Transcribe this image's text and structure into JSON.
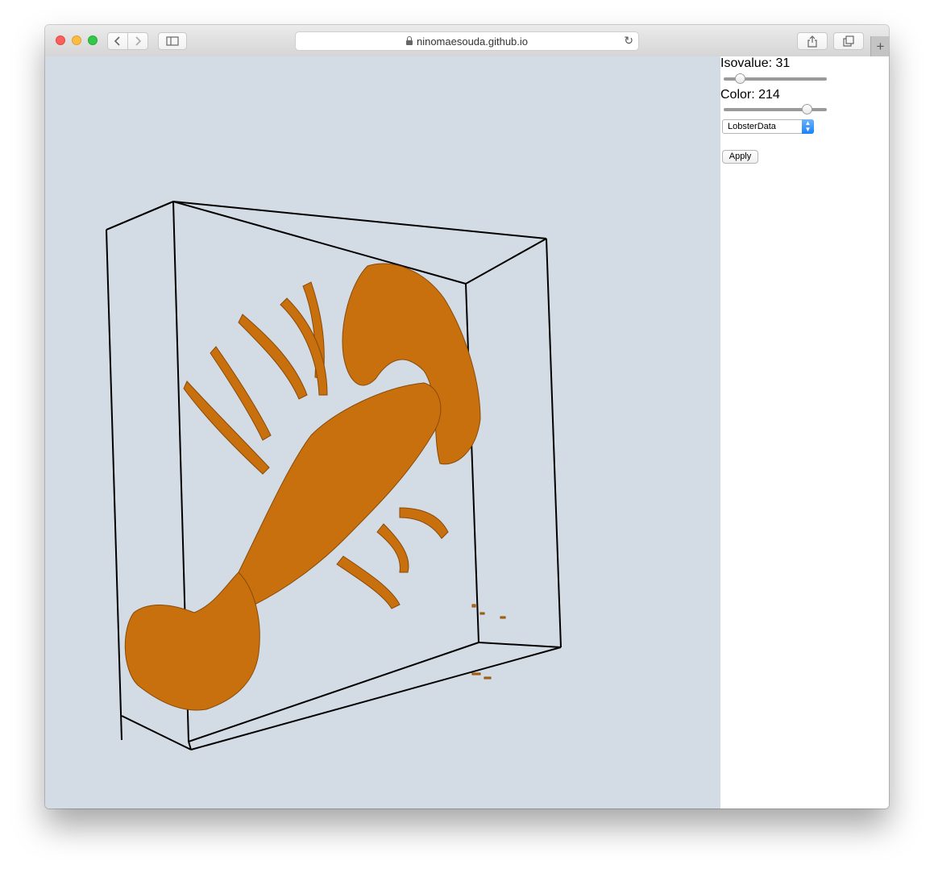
{
  "browser": {
    "url": "ninomaesouda.github.io",
    "new_tab_label": "+"
  },
  "viewer": {
    "background_color": "#d3dbe4",
    "surface_color": "#c8700e",
    "object": "lobster isosurface"
  },
  "controls": {
    "isovalue_label": "Isovalue: 31",
    "isovalue": 31,
    "color_label": "Color: 214",
    "color": 214,
    "dataset_selected": "LobsterData",
    "apply_label": "Apply"
  }
}
